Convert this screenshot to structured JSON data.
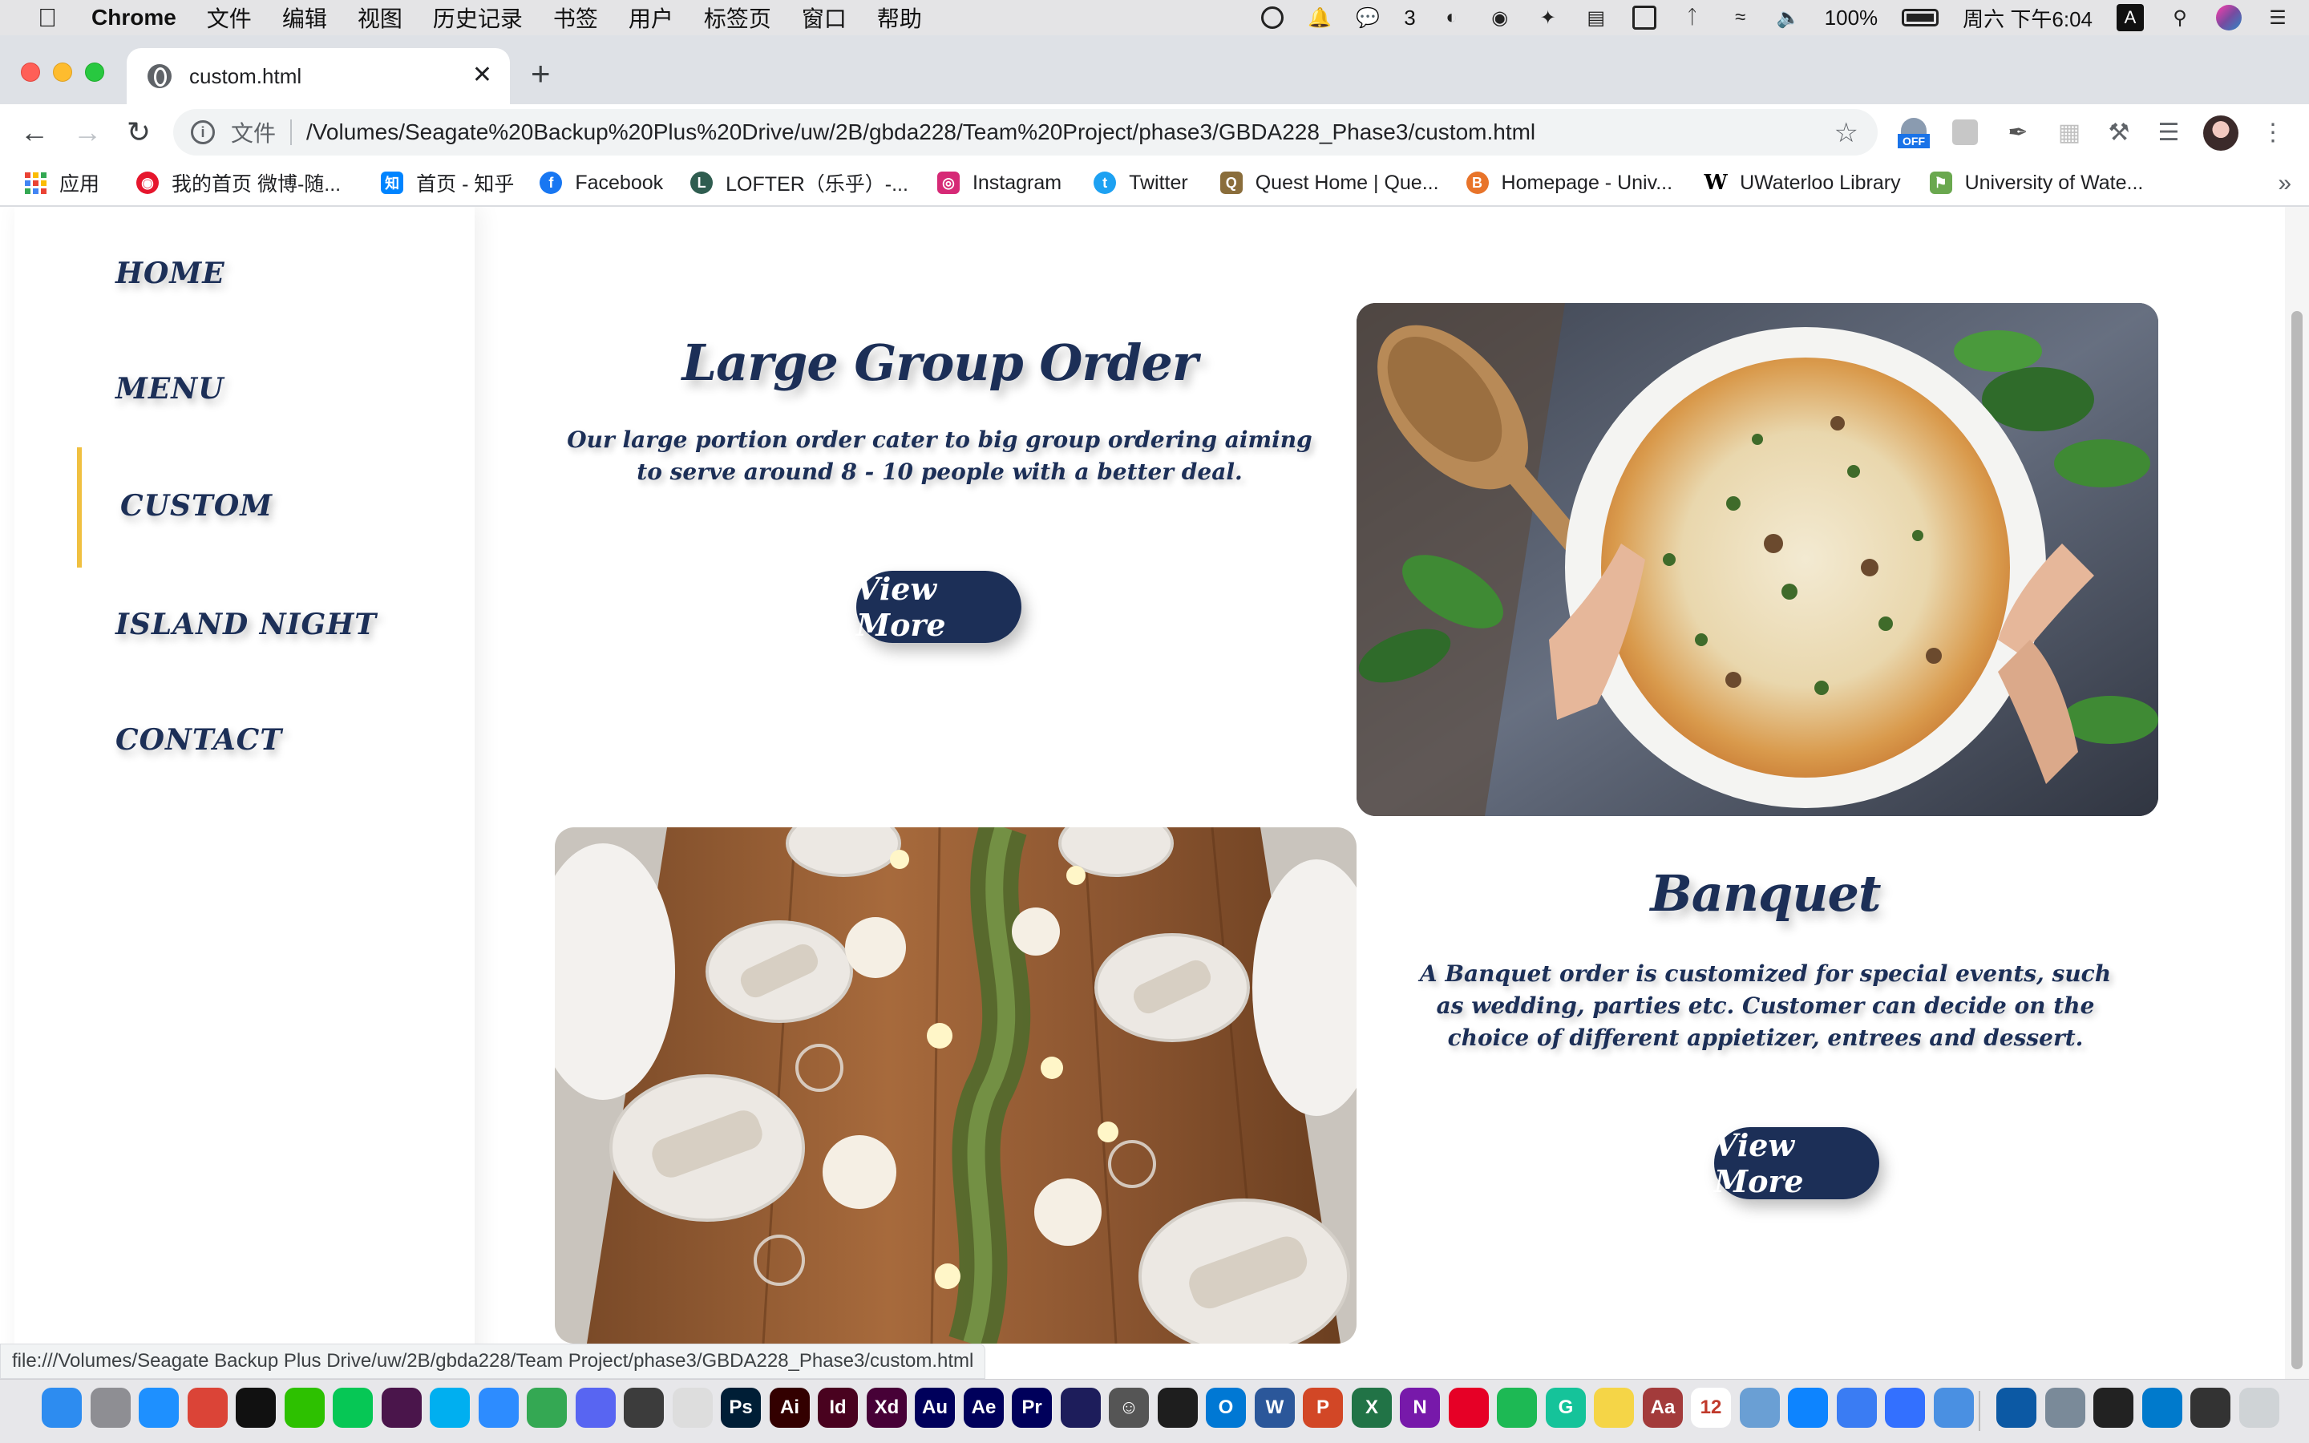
{
  "menubar": {
    "app_name": "Chrome",
    "items": [
      "文件",
      "编辑",
      "视图",
      "历史记录",
      "书签",
      "用户",
      "标签页",
      "窗口",
      "帮助"
    ],
    "wechat_count": "3",
    "battery": "100%",
    "clock": "周六 下午6:04",
    "ime": "A"
  },
  "tab": {
    "title": "custom.html",
    "close": "✕",
    "new_tab": "+"
  },
  "toolbar": {
    "back": "←",
    "forward": "→",
    "reload": "↻",
    "scheme": "文件",
    "url": "/Volumes/Seagate%20Backup%20Plus%20Drive/uw/2B/gbda228/Team%20Project/phase3/GBDA228_Phase3/custom.html",
    "star": "☆",
    "ext_off_label": "OFF"
  },
  "bookmarks": [
    {
      "label": "应用",
      "icon": "apps-grid-icon",
      "color": "#ea4335"
    },
    {
      "label": "我的首页 微博-随...",
      "icon": "weibo-icon",
      "color": "#e6162d"
    },
    {
      "label": "首页 - 知乎",
      "icon": "zhihu-icon",
      "color": "#0084ff",
      "glyph": "知"
    },
    {
      "label": "Facebook",
      "icon": "facebook-icon",
      "color": "#1877f2",
      "glyph": "f"
    },
    {
      "label": "LOFTER（乐乎）-...",
      "icon": "lofter-icon",
      "color": "#2f5d50",
      "glyph": "L"
    },
    {
      "label": "Instagram",
      "icon": "instagram-icon",
      "color": "#d62976",
      "glyph": "◎"
    },
    {
      "label": "Twitter",
      "icon": "twitter-icon",
      "color": "#1da1f2",
      "glyph": "t"
    },
    {
      "label": "Quest Home | Que...",
      "icon": "quest-icon",
      "color": "#8a6d3b",
      "glyph": "Q"
    },
    {
      "label": "Homepage - Univ...",
      "icon": "homepage-icon",
      "color": "#e8742a",
      "glyph": "B"
    },
    {
      "label": "UWaterloo Library",
      "icon": "wikipedia-w-icon",
      "color": "#000000",
      "glyph": "W"
    },
    {
      "label": "University of Wate...",
      "icon": "uwaterloo-flag-icon",
      "color": "#6aa84f",
      "glyph": "⚑"
    }
  ],
  "bookmarks_more": "»",
  "sidebar": {
    "items": [
      {
        "label": "HOME"
      },
      {
        "label": "MENU"
      },
      {
        "label": "CUSTOM",
        "active": true
      },
      {
        "label": "ISLAND NIGHT"
      },
      {
        "label": "CONTACT"
      }
    ],
    "accent_color": "#f0c040"
  },
  "cards": [
    {
      "title": "Large Group Order",
      "description": "Our large portion order cater to big group ordering aiming to serve around 8 - 10 people with a better deal.",
      "button": "View More",
      "image": "casserole-dish-photo"
    },
    {
      "title": "Banquet",
      "description": "A Banquet order is customized for special events, such as wedding, parties etc. Customer can decide on the choice of different appietizer, entrees and dessert.",
      "button": "View More",
      "image": "banquet-table-photo"
    }
  ],
  "colors": {
    "brand_navy": "#1c2f57",
    "accent_gold": "#f0c040"
  },
  "statusbar": {
    "text": "file:///Volumes/Seagate Backup Plus Drive/uw/2B/gbda228/Team Project/phase3/GBDA228_Phase3/custom.html"
  },
  "dock": {
    "apps": [
      {
        "name": "finder-icon",
        "label": "",
        "color": "#2d8cf0"
      },
      {
        "name": "launchpad-icon",
        "label": "",
        "color": "#8e8e93"
      },
      {
        "name": "safari-icon",
        "label": "",
        "color": "#1e90ff"
      },
      {
        "name": "chrome-icon",
        "label": "",
        "color": "#db4437"
      },
      {
        "name": "qq-icon",
        "label": "",
        "color": "#111111"
      },
      {
        "name": "wechat-icon",
        "label": "",
        "color": "#2dc100"
      },
      {
        "name": "line-icon",
        "label": "",
        "color": "#06c755"
      },
      {
        "name": "slack-icon",
        "label": "",
        "color": "#4a154b"
      },
      {
        "name": "skype-icon",
        "label": "",
        "color": "#00aff0"
      },
      {
        "name": "zoom-icon",
        "label": "",
        "color": "#2d8cff"
      },
      {
        "name": "maps-icon",
        "label": "",
        "color": "#34a853"
      },
      {
        "name": "discord-icon",
        "label": "",
        "color": "#5865f2"
      },
      {
        "name": "facetime-icon",
        "label": "",
        "color": "#3c3c3c"
      },
      {
        "name": "clock-icon",
        "label": "",
        "color": "#dddddd"
      },
      {
        "name": "photoshop-icon",
        "label": "Ps",
        "color": "#001e36"
      },
      {
        "name": "illustrator-icon",
        "label": "Ai",
        "color": "#330000"
      },
      {
        "name": "indesign-icon",
        "label": "Id",
        "color": "#49021f"
      },
      {
        "name": "xd-icon",
        "label": "Xd",
        "color": "#470137"
      },
      {
        "name": "audition-icon",
        "label": "Au",
        "color": "#00005b"
      },
      {
        "name": "after-effects-icon",
        "label": "Ae",
        "color": "#00005b"
      },
      {
        "name": "premiere-icon",
        "label": "Pr",
        "color": "#00005b"
      },
      {
        "name": "media-encoder-icon",
        "label": "",
        "color": "#1d1d5b"
      },
      {
        "name": "smiley-icon",
        "label": "☺",
        "color": "#555555"
      },
      {
        "name": "figma-icon",
        "label": "",
        "color": "#1e1e1e"
      },
      {
        "name": "outlook-icon",
        "label": "O",
        "color": "#0078d4"
      },
      {
        "name": "word-icon",
        "label": "W",
        "color": "#2b579a"
      },
      {
        "name": "powerpoint-icon",
        "label": "P",
        "color": "#d24726"
      },
      {
        "name": "excel-icon",
        "label": "X",
        "color": "#217346"
      },
      {
        "name": "onenote-icon",
        "label": "N",
        "color": "#7719aa"
      },
      {
        "name": "netease-music-icon",
        "label": "",
        "color": "#e60026"
      },
      {
        "name": "spotify-icon",
        "label": "",
        "color": "#1db954"
      },
      {
        "name": "grammarly-icon",
        "label": "G",
        "color": "#15c39a"
      },
      {
        "name": "stickies-icon",
        "label": "",
        "color": "#f5d547"
      },
      {
        "name": "dictionary-icon",
        "label": "Aa",
        "color": "#a33b3b"
      },
      {
        "name": "calendar-icon",
        "label": "12",
        "color": "#ffffff"
      },
      {
        "name": "preview-icon",
        "label": "",
        "color": "#6a9fd4"
      },
      {
        "name": "app-store-icon",
        "label": "",
        "color": "#0d84ff"
      },
      {
        "name": "baidu-netdisk-icon",
        "label": "",
        "color": "#3a7cf3"
      },
      {
        "name": "feishu-icon",
        "label": "",
        "color": "#3370ff"
      },
      {
        "name": "mail-icon",
        "label": "",
        "color": "#4a90e2"
      },
      {
        "name": "edge-icon",
        "label": "",
        "color": "#0c59a4"
      },
      {
        "name": "scanner-icon",
        "label": "",
        "color": "#7a8a99"
      },
      {
        "name": "terminal-icon",
        "label": "",
        "color": "#222222"
      },
      {
        "name": "vscode-icon",
        "label": "",
        "color": "#007acc"
      },
      {
        "name": "screen-icon",
        "label": "",
        "color": "#333333"
      },
      {
        "name": "trash-icon",
        "label": "",
        "color": "#cfd3d6"
      }
    ]
  }
}
